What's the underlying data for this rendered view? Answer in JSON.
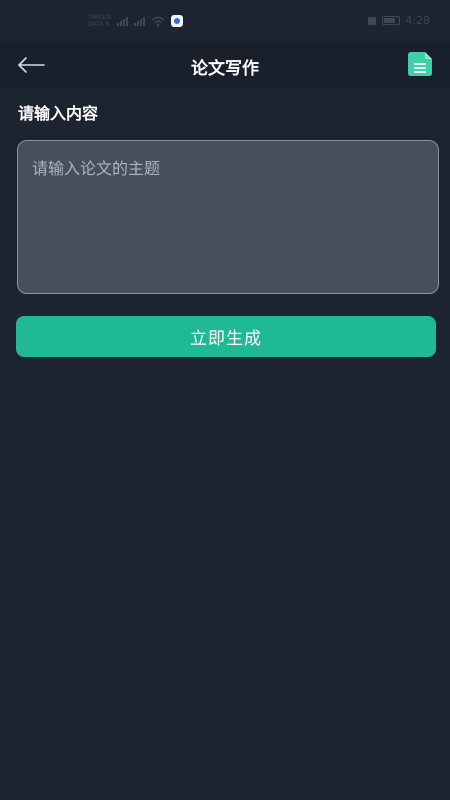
{
  "status_bar": {
    "time": "4:28",
    "network_top": "TIMEUN",
    "network_bottom": "DATA B",
    "icons": [
      "signal-icon",
      "signal-icon",
      "wifi-icon",
      "app-badge-icon",
      "battery-icon"
    ]
  },
  "header": {
    "back_icon": "back-arrow-icon",
    "title": "论文写作",
    "doc_icon": "document-list-icon"
  },
  "main": {
    "section_label": "请输入内容",
    "topic_input": {
      "value": "",
      "placeholder": "请输入论文的主题"
    },
    "generate_button_label": "立即生成"
  },
  "colors": {
    "background": "#1c2430",
    "header_background": "#1a202b",
    "input_background": "#474f5c",
    "input_border": "#8a929e",
    "accent": "#20b995",
    "doc_icon": "#3fd0a8"
  }
}
